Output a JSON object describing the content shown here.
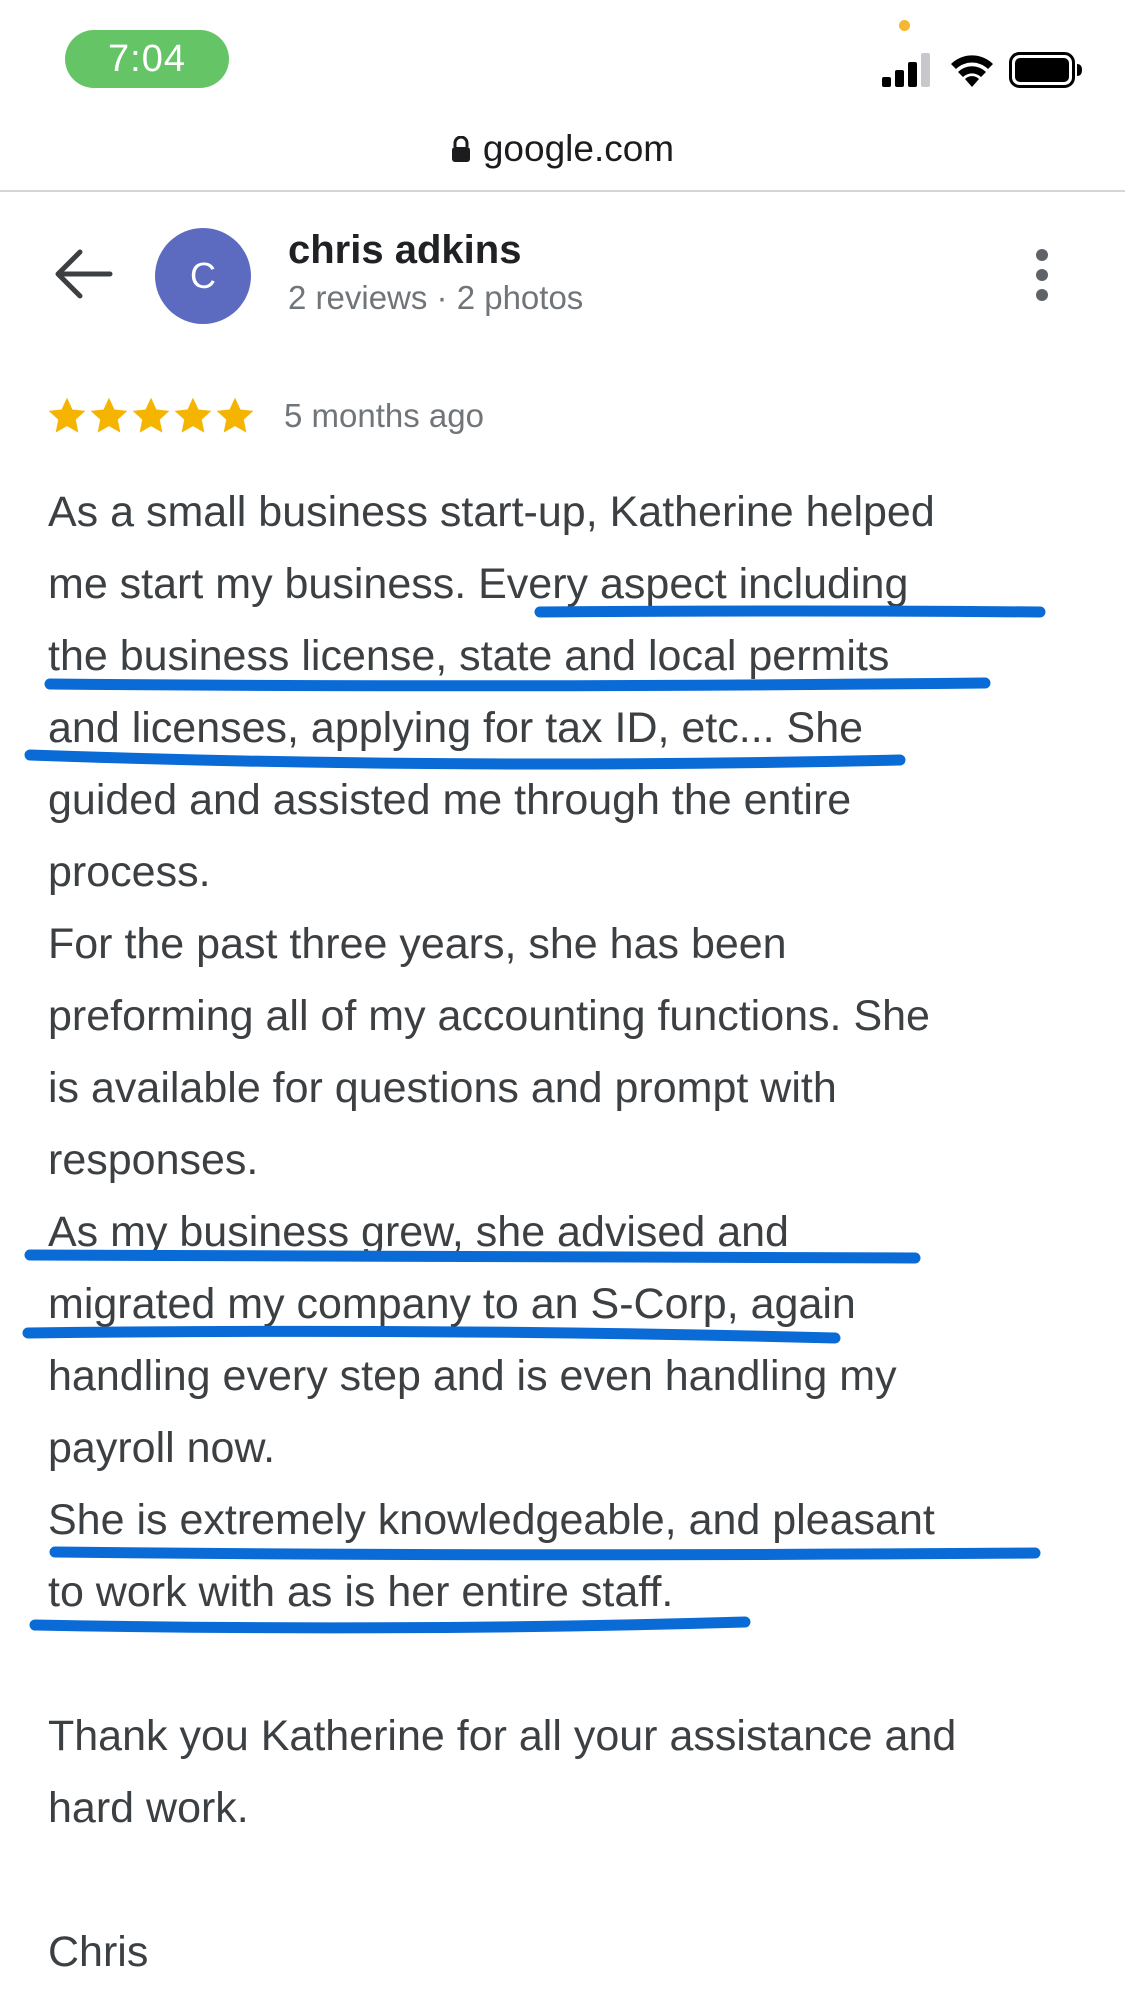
{
  "status_bar": {
    "time": "7:04",
    "icons": [
      "cellular-signal-icon",
      "wifi-icon",
      "battery-icon"
    ]
  },
  "browser": {
    "domain": "google.com",
    "lock_icon": "lock-icon"
  },
  "header": {
    "back_icon": "arrow-left-icon",
    "avatar_letter": "C",
    "avatar_color": "#5c6bc0",
    "name": "chris adkins",
    "meta": "2 reviews · 2 photos",
    "more_icon": "more-vertical-icon"
  },
  "review": {
    "rating": 5,
    "star_color": "#f4b400",
    "date": "5 months ago",
    "lines": [
      "As a small business start-up, Katherine helped",
      "me start my business. Every aspect including",
      "the business license, state and local permits",
      "and licenses, applying for tax ID, etc... She",
      "guided and assisted me through the entire",
      "process.",
      "For the past three years, she has been",
      "preforming all of my accounting functions. She",
      "is available for questions and prompt with",
      "responses.",
      "As my business grew, she advised and",
      "migrated my company to an S-Corp, again",
      "handling every step and is even handling my",
      "payroll now.",
      "She is extremely knowledgeable, and pleasant",
      "to work with as is her entire staff.",
      "",
      "Thank you Katherine for all your assistance and",
      "hard work.",
      "",
      "Chris"
    ],
    "highlight_color": "#0a6bd6"
  }
}
